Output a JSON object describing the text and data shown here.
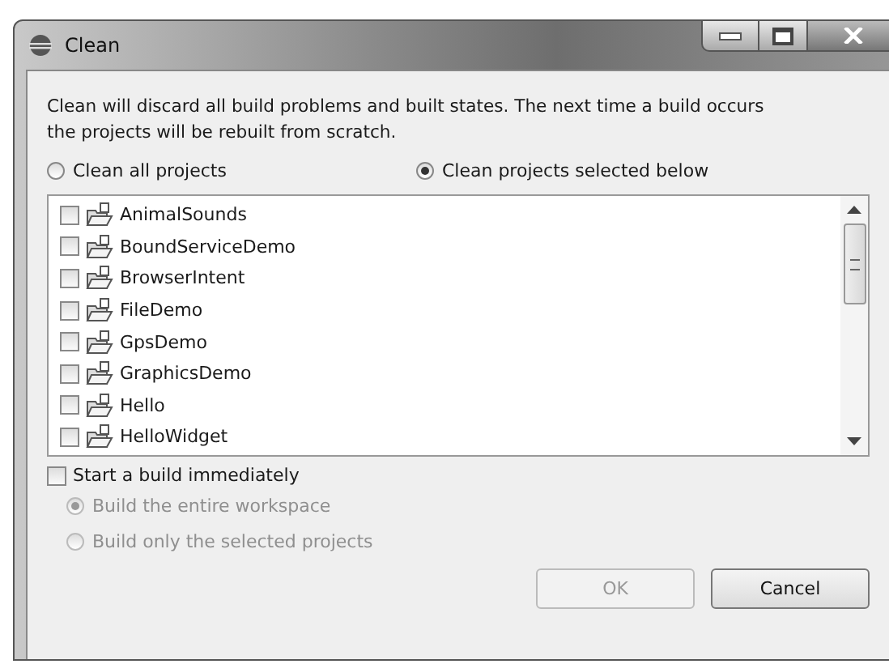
{
  "window": {
    "title": "Clean"
  },
  "description": "Clean will discard all build problems and built states.  The next time a build occurs the projects will be rebuilt from scratch.",
  "clean_mode": [
    {
      "label": "Clean all projects",
      "selected": false
    },
    {
      "label": "Clean projects selected below",
      "selected": true
    }
  ],
  "projects": [
    {
      "name": "AnimalSounds",
      "checked": false
    },
    {
      "name": "BoundServiceDemo",
      "checked": false
    },
    {
      "name": "BrowserIntent",
      "checked": false
    },
    {
      "name": "FileDemo",
      "checked": false
    },
    {
      "name": "GpsDemo",
      "checked": false
    },
    {
      "name": "GraphicsDemo",
      "checked": false
    },
    {
      "name": "Hello",
      "checked": false
    },
    {
      "name": "HelloWidget",
      "checked": false
    }
  ],
  "start_build": {
    "label": "Start a build immediately",
    "checked": false
  },
  "build_scope": [
    {
      "label": "Build the entire workspace",
      "selected": true,
      "disabled": true
    },
    {
      "label": "Build only the selected projects",
      "selected": false,
      "disabled": true
    }
  ],
  "buttons": [
    {
      "label": "OK",
      "disabled": true
    },
    {
      "label": "Cancel",
      "disabled": false
    }
  ]
}
